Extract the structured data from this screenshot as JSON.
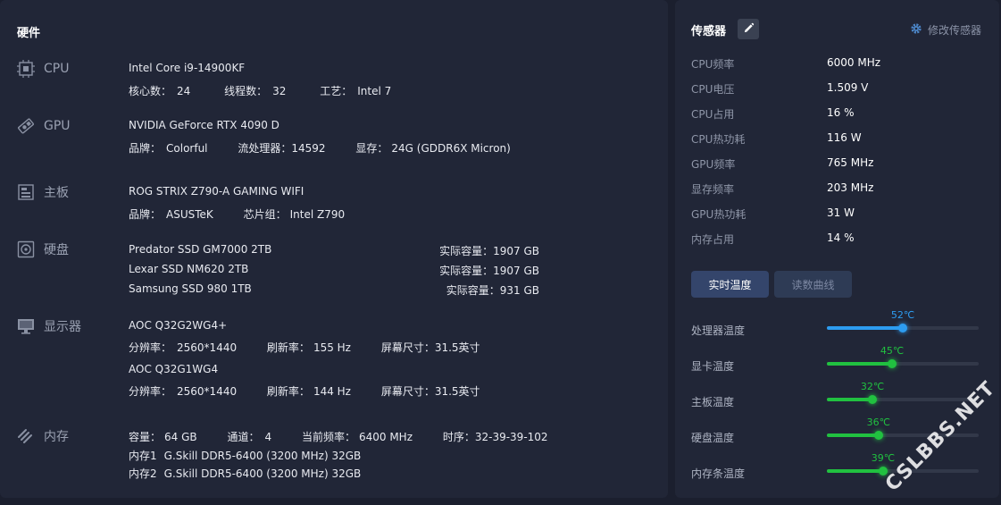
{
  "hardware": {
    "title": "硬件",
    "cpu": {
      "label": "CPU",
      "model": "Intel Core i9-14900KF",
      "cores_k": "核心数：",
      "cores_v": "24",
      "threads_k": "线程数：",
      "threads_v": "32",
      "process_k": "工艺：",
      "process_v": "Intel 7"
    },
    "gpu": {
      "label": "GPU",
      "model": "NVIDIA GeForce RTX 4090 D",
      "brand_k": "品牌：",
      "brand_v": "Colorful",
      "stream_k": "流处理器：",
      "stream_v": "14592",
      "vram_k": "显存：",
      "vram_v": "24G (GDDR6X Micron)"
    },
    "motherboard": {
      "label": "主板",
      "model": "ROG STRIX Z790-A GAMING WIFI",
      "brand_k": "品牌：",
      "brand_v": "ASUSTeK",
      "chipset_k": "芯片组：",
      "chipset_v": "Intel Z790"
    },
    "disk": {
      "label": "硬盘",
      "drives": [
        {
          "name": "Predator SSD GM7000 2TB",
          "cap": "实际容量：1907 GB"
        },
        {
          "name": "Lexar SSD NM620 2TB",
          "cap": "实际容量：1907 GB"
        },
        {
          "name": "Samsung SSD 980 1TB",
          "cap": "实际容量：931 GB"
        }
      ]
    },
    "display": {
      "label": "显示器",
      "monitors": [
        {
          "model": "AOC Q32G2WG4+",
          "res_k": "分辨率：",
          "res_v": "2560*1440",
          "rate_k": "刷新率：",
          "rate_v": "155 Hz",
          "size_k": "屏幕尺寸：",
          "size_v": "31.5英寸"
        },
        {
          "model": "AOC Q32G1WG4",
          "res_k": "分辨率：",
          "res_v": "2560*1440",
          "rate_k": "刷新率：",
          "rate_v": "144 Hz",
          "size_k": "屏幕尺寸：",
          "size_v": "31.5英寸"
        }
      ]
    },
    "memory": {
      "label": "内存",
      "cap_k": "容量：",
      "cap_v": "64 GB",
      "ch_k": "通道：",
      "ch_v": "4",
      "freq_k": "当前频率：",
      "freq_v": "6400 MHz",
      "tim_k": "时序：",
      "tim_v": "32-39-39-102",
      "sticks": [
        {
          "slot": "内存1",
          "name": "G.Skill DDR5-6400 (3200 MHz) 32GB"
        },
        {
          "slot": "内存2",
          "name": "G.Skill DDR5-6400 (3200 MHz) 32GB"
        }
      ]
    }
  },
  "sensors": {
    "title": "传感器",
    "modify_label": "修改传感器",
    "readings": [
      {
        "k": "CPU频率",
        "v": "6000 MHz"
      },
      {
        "k": "CPU电压",
        "v": "1.509 V"
      },
      {
        "k": "CPU占用",
        "v": "16 %"
      },
      {
        "k": "CPU热功耗",
        "v": "116 W"
      },
      {
        "k": "GPU频率",
        "v": "765 MHz"
      },
      {
        "k": "显存频率",
        "v": "203 MHz"
      },
      {
        "k": "GPU热功耗",
        "v": "31 W"
      },
      {
        "k": "内存占用",
        "v": "14 %"
      }
    ],
    "tabs": {
      "realtime": "实时温度",
      "curve": "读数曲线"
    },
    "temps": [
      {
        "label": "处理器温度",
        "value": "52℃",
        "fraction": 0.5,
        "color": "#2d9cf0"
      },
      {
        "label": "显卡温度",
        "value": "45℃",
        "fraction": 0.43,
        "color": "#21c140"
      },
      {
        "label": "主板温度",
        "value": "32℃",
        "fraction": 0.3,
        "color": "#21c140"
      },
      {
        "label": "硬盘温度",
        "value": "36℃",
        "fraction": 0.34,
        "color": "#21c140"
      },
      {
        "label": "内存条温度",
        "value": "39℃",
        "fraction": 0.37,
        "color": "#21c140"
      }
    ]
  },
  "watermark": "CSLBBS.NET"
}
